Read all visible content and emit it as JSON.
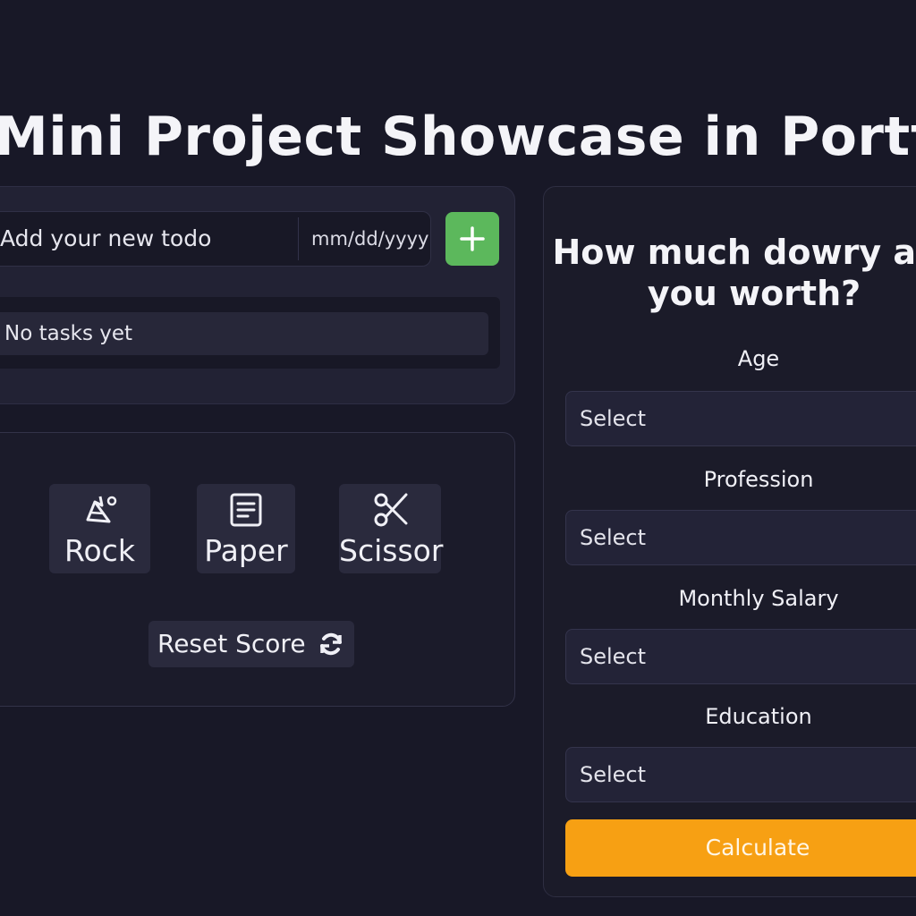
{
  "page": {
    "title": "Mini Project Showcase in Portfolio"
  },
  "todo": {
    "input_placeholder": "Add your new todo",
    "date_placeholder": "mm/dd/yyyy",
    "add_icon": "plus-icon",
    "empty_text": "No tasks yet",
    "add_color": "#5cb85c"
  },
  "rps": {
    "choices": [
      {
        "label": "Rock",
        "icon": "rock-icon"
      },
      {
        "label": "Paper",
        "icon": "paper-icon"
      },
      {
        "label": "Scissor",
        "icon": "scissors-icon"
      }
    ],
    "reset_label": "Reset Score",
    "reset_icon": "refresh-icon"
  },
  "dowry": {
    "title": "How much dowry are you worth?",
    "fields": [
      {
        "label": "Age",
        "value": "Select"
      },
      {
        "label": "Profession",
        "value": "Select"
      },
      {
        "label": "Monthly Salary",
        "value": "Select"
      },
      {
        "label": "Education",
        "value": "Select"
      }
    ],
    "calculate_label": "Calculate",
    "calculate_color": "#f7a013"
  }
}
